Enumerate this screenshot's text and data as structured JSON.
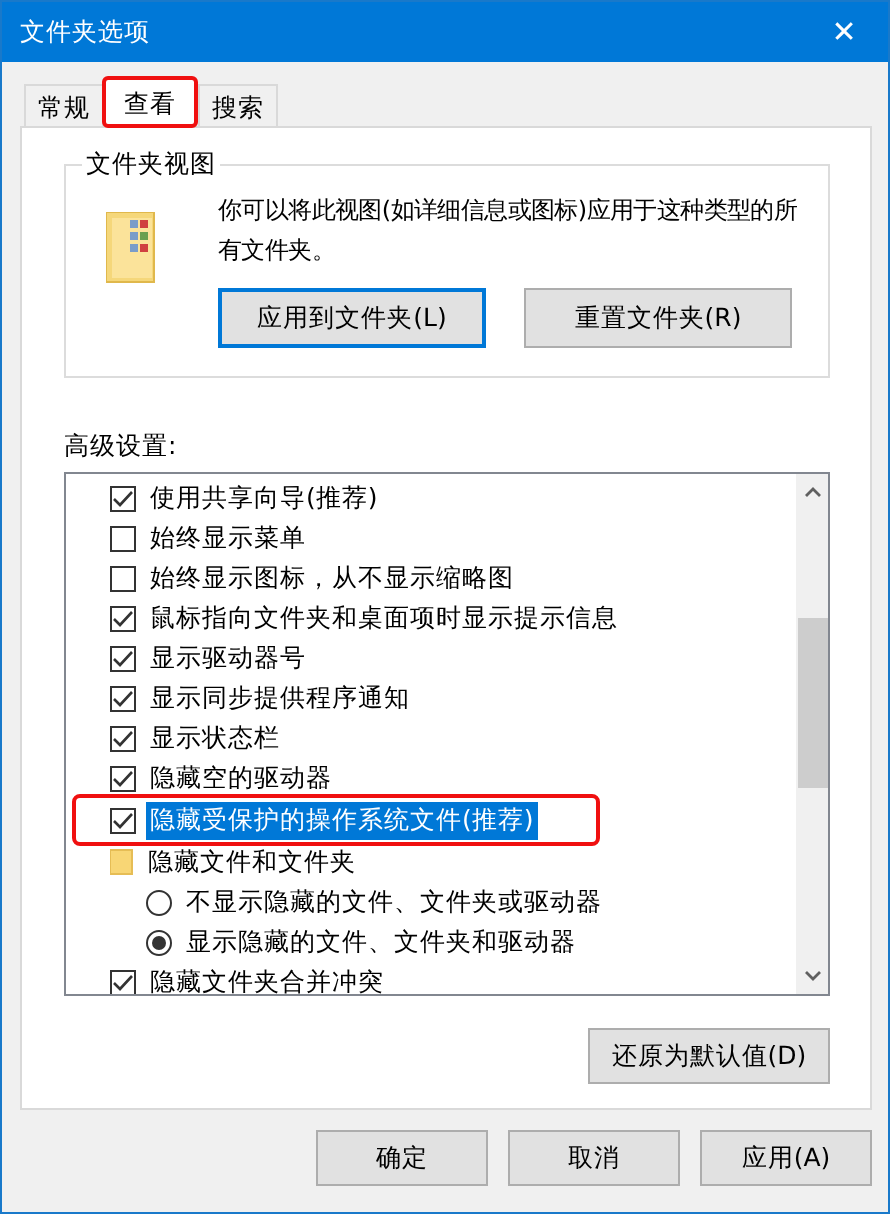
{
  "window": {
    "title": "文件夹选项",
    "close": "✕"
  },
  "tabs": [
    {
      "label": "常规",
      "selected": false,
      "highlighted": false
    },
    {
      "label": "查看",
      "selected": true,
      "highlighted": true
    },
    {
      "label": "搜索",
      "selected": false,
      "highlighted": false
    }
  ],
  "folder_views": {
    "title": "文件夹视图",
    "description": "你可以将此视图(如详细信息或图标)应用于这种类型的所有文件夹。",
    "buttons": [
      {
        "label": "应用到文件夹(L)",
        "focused": true
      },
      {
        "label": "重置文件夹(R)",
        "focused": false
      }
    ]
  },
  "advanced": {
    "label": "高级设置:",
    "items": [
      {
        "kind": "checkbox",
        "label": "使用共享向导(推荐)",
        "checked": true,
        "selected": false,
        "highlighted": false
      },
      {
        "kind": "checkbox",
        "label": "始终显示菜单",
        "checked": false,
        "selected": false,
        "highlighted": false
      },
      {
        "kind": "checkbox",
        "label": "始终显示图标，从不显示缩略图",
        "checked": false,
        "selected": false,
        "highlighted": false
      },
      {
        "kind": "checkbox",
        "label": "鼠标指向文件夹和桌面项时显示提示信息",
        "checked": true,
        "selected": false,
        "highlighted": false
      },
      {
        "kind": "checkbox",
        "label": "显示驱动器号",
        "checked": true,
        "selected": false,
        "highlighted": false
      },
      {
        "kind": "checkbox",
        "label": "显示同步提供程序通知",
        "checked": true,
        "selected": false,
        "highlighted": false
      },
      {
        "kind": "checkbox",
        "label": "显示状态栏",
        "checked": true,
        "selected": false,
        "highlighted": false
      },
      {
        "kind": "checkbox",
        "label": "隐藏空的驱动器",
        "checked": true,
        "selected": false,
        "highlighted": false
      },
      {
        "kind": "checkbox",
        "label": "隐藏受保护的操作系统文件(推荐)",
        "checked": true,
        "selected": true,
        "highlighted": true
      },
      {
        "kind": "folder",
        "label": "隐藏文件和文件夹",
        "children": [
          {
            "kind": "radio",
            "label": "不显示隐藏的文件、文件夹或驱动器",
            "checked": false
          },
          {
            "kind": "radio",
            "label": "显示隐藏的文件、文件夹和驱动器",
            "checked": true
          }
        ]
      },
      {
        "kind": "checkbox",
        "label": "隐藏文件夹合并冲突",
        "checked": true,
        "selected": false,
        "highlighted": false
      }
    ],
    "restore_button": "还原为默认值(D)"
  },
  "buttons": [
    "确定",
    "取消",
    "应用(A)"
  ]
}
